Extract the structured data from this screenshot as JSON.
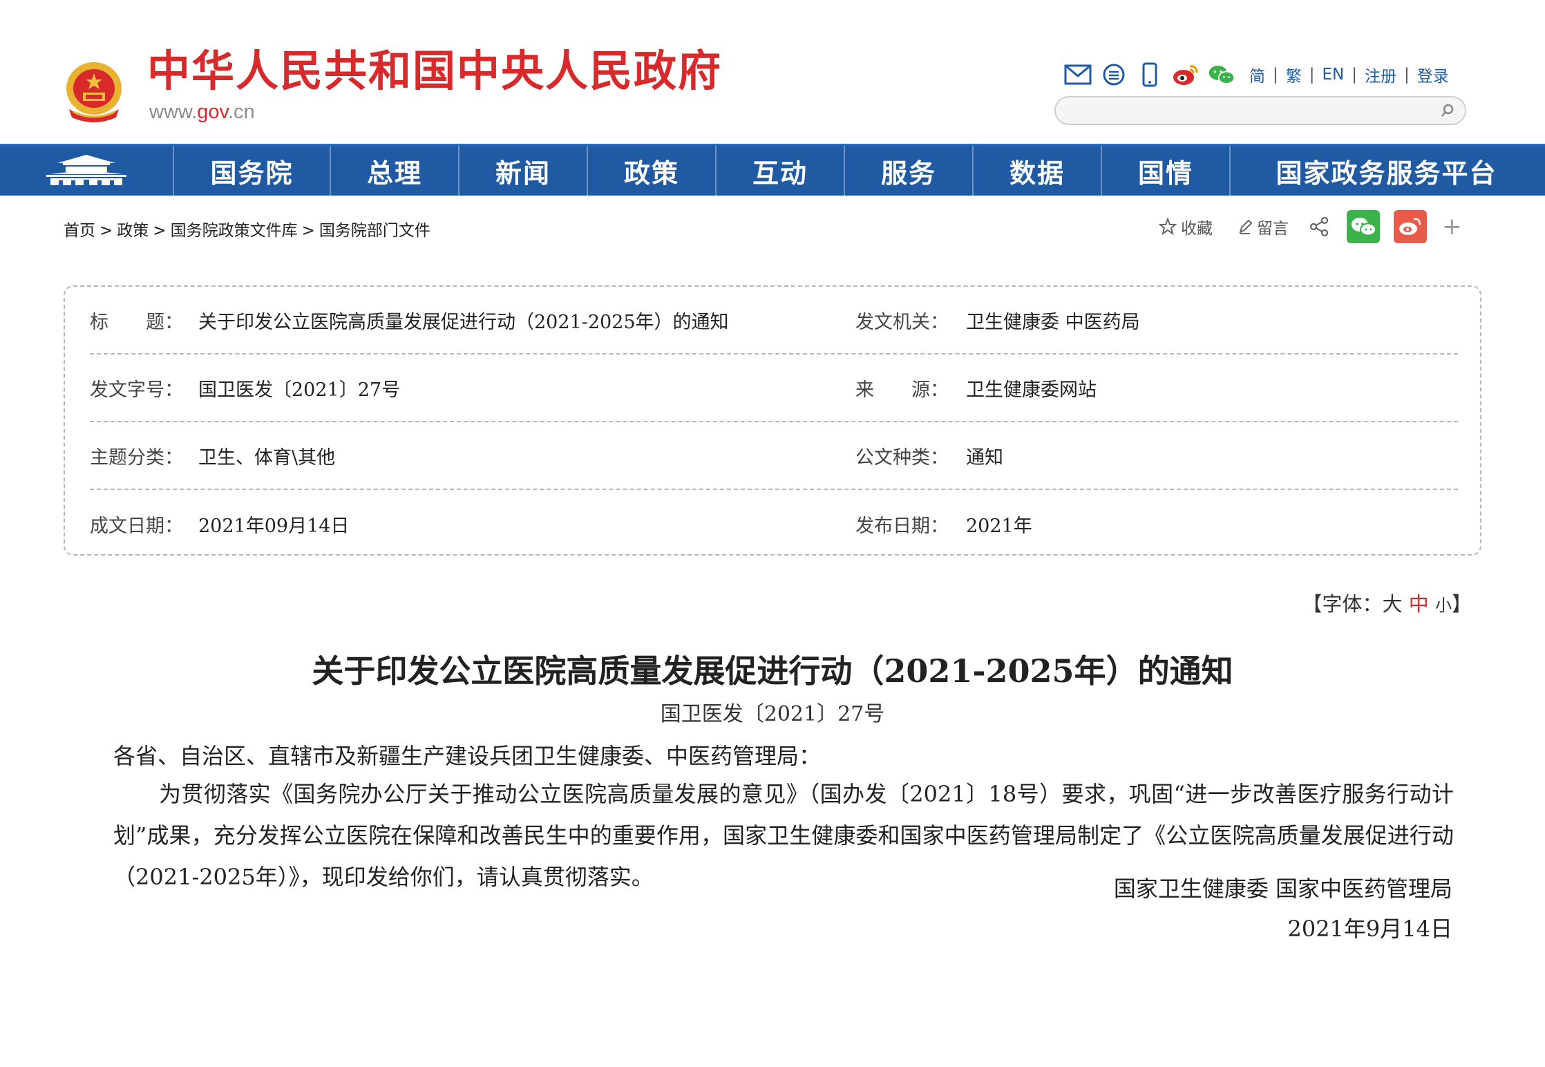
{
  "header": {
    "site_title": "中华人民共和国中央人民政府",
    "url_prefix": "www.",
    "url_gov": "gov",
    "url_suffix": ".cn",
    "icons": [
      "mail-icon",
      "rss-icon",
      "mobile-icon",
      "weibo-icon",
      "wechat-icon"
    ],
    "languages": [
      "简",
      "繁",
      "EN",
      "注册",
      "登录"
    ],
    "search": {
      "placeholder": "",
      "value": ""
    }
  },
  "nav": {
    "items": [
      "国务院",
      "总理",
      "新闻",
      "政策",
      "互动",
      "服务",
      "数据",
      "国情",
      "国家政务服务平台"
    ]
  },
  "breadcrumb": [
    "首页",
    "政策",
    "国务院政策文件库",
    "国务院部门文件"
  ],
  "tools": {
    "favorite": "收藏",
    "comment": "留言",
    "more": "+"
  },
  "info": {
    "rows": [
      {
        "l_label": "标　　题：",
        "l_value": "关于印发公立医院高质量发展促进行动（2021-2025年）的通知",
        "r_label": "发文机关：",
        "r_value": "卫生健康委 中医药局"
      },
      {
        "l_label": "发文字号：",
        "l_value": "国卫医发〔2021〕27号",
        "r_label": "来　　源：",
        "r_value": "卫生健康委网站"
      },
      {
        "l_label": "主题分类：",
        "l_value": "卫生、体育\\其他",
        "r_label": "公文种类：",
        "r_value": "通知"
      },
      {
        "l_label": "成文日期：",
        "l_value": "2021年09月14日",
        "r_label": "发布日期：",
        "r_value": "2021年"
      }
    ]
  },
  "font_size": {
    "prefix": "【字体：",
    "large": "大",
    "medium": "中",
    "small": "小",
    "suffix": "】"
  },
  "document": {
    "title": "关于印发公立医院高质量发展促进行动（2021-2025年）的通知",
    "number": "国卫医发〔2021〕27号",
    "greeting": "各省、自治区、直辖市及新疆生产建设兵团卫生健康委、中医药管理局：",
    "body": "为贯彻落实《国务院办公厅关于推动公立医院高质量发展的意见》（国办发〔2021〕18号）要求，巩固“进一步改善医疗服务行动计划”成果，充分发挥公立医院在保障和改善民生中的重要作用，国家卫生健康委和国家中医药管理局制定了《公立医院高质量发展促进行动（2021-2025年）》，现印发给你们，请认真贯彻落实。",
    "signer": "国家卫生健康委 国家中医药管理局",
    "date": "2021年9月14日"
  },
  "colors": {
    "brand_red": "#d8292b",
    "nav_blue": "#1f5aa3",
    "link_blue": "#1f5aa8"
  }
}
